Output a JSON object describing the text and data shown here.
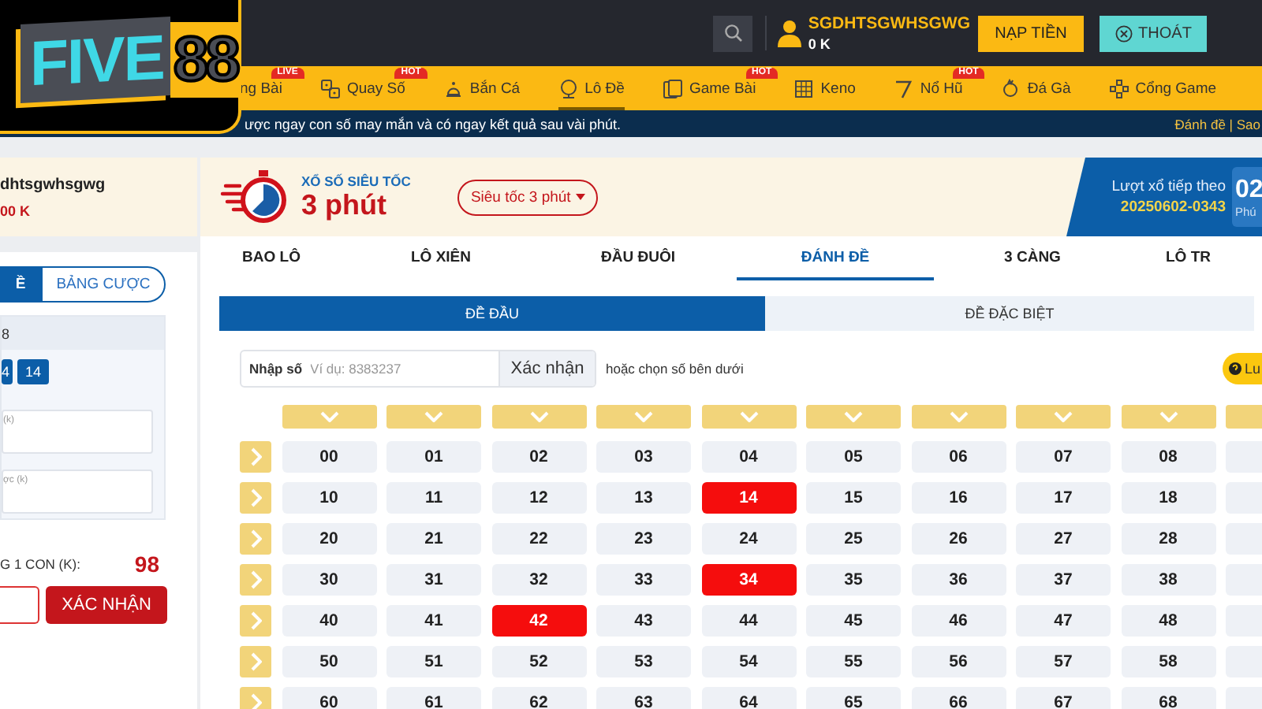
{
  "logo": {
    "word": "FIVE",
    "number": "88"
  },
  "account_bar": {
    "username": "SGDHTSGWHSGWG",
    "balance": "0 K",
    "deposit_button": "NẠP TIỀN",
    "logout_button": "THOÁT"
  },
  "nav": [
    {
      "label": "ng Bài",
      "kind": "cut",
      "badge": "LIVE",
      "selected": false
    },
    {
      "label": "Quay Số",
      "kind": "dice",
      "badge": "HOT",
      "selected": false
    },
    {
      "label": "Bắn Cá",
      "kind": "fish",
      "selected": false
    },
    {
      "label": "Lô Đề",
      "kind": "ball",
      "selected": true
    },
    {
      "label": "Game Bài",
      "kind": "cards",
      "badge": "HOT",
      "selected": false
    },
    {
      "label": "Keno",
      "kind": "grid",
      "selected": false
    },
    {
      "label": "Nổ Hũ",
      "kind": "seven",
      "badge": "HOT",
      "selected": false
    },
    {
      "label": "Đá Gà",
      "kind": "rooster",
      "selected": false
    },
    {
      "label": "Cổng Game",
      "kind": "pad",
      "selected": false
    }
  ],
  "ticker": {
    "message": "ược ngay con số may mắn và có ngay kết quả sau vài phút.",
    "links": "Đánh đề | Sao"
  },
  "sidebar": {
    "account_name": "dhtsgwhsgwg",
    "account_balance": "00 K",
    "tabs": [
      {
        "label": "Ề",
        "selected": true
      },
      {
        "label": "BẢNG CƯỢC",
        "selected": false
      }
    ],
    "ticket": {
      "title": "8",
      "numbers": [
        "4",
        "14"
      ],
      "fields": [
        {
          "label": "(k)"
        },
        {
          "label": "ợc (k)"
        }
      ]
    },
    "total_label": "G 1 CON (K):",
    "total_value": "98",
    "confirm_button": "XÁC NHẬN"
  },
  "game": {
    "subtitle": "XỔ SỐ SIÊU TỐC",
    "title": "3 phút",
    "mode_dropdown": "Siêu tốc 3 phút",
    "next_draw_label": "Lượt xổ tiếp theo",
    "next_draw_id": "20250602-0343",
    "countdown_value": "02",
    "countdown_unit": "Phú"
  },
  "bet_tabs": [
    {
      "label": "BAO LÔ",
      "selected": false
    },
    {
      "label": "LÔ XIÊN",
      "selected": false
    },
    {
      "label": "ĐẦU ĐUÔI",
      "selected": false
    },
    {
      "label": "ĐÁNH ĐỀ",
      "selected": true
    },
    {
      "label": "3 CÀNG",
      "selected": false
    },
    {
      "label": "LÔ TR",
      "selected": false
    }
  ],
  "sub_tabs": [
    {
      "label": "ĐỀ ĐẦU",
      "selected": true
    },
    {
      "label": "ĐỀ ĐẶC BIỆT",
      "selected": false
    }
  ],
  "number_input": {
    "label": "Nhập số",
    "placeholder": "Ví dụ: 8383237",
    "button": "Xác nhận",
    "hint": "hoặc chọn số bên dưới"
  },
  "help_button": "Lu",
  "number_grid": {
    "rows": [
      {
        "cells": [
          {
            "label": "00",
            "selected": false
          },
          {
            "label": "01",
            "selected": false
          },
          {
            "label": "02",
            "selected": false
          },
          {
            "label": "03",
            "selected": false
          },
          {
            "label": "04",
            "selected": false
          },
          {
            "label": "05",
            "selected": false
          },
          {
            "label": "06",
            "selected": false
          },
          {
            "label": "07",
            "selected": false
          },
          {
            "label": "08",
            "selected": false
          }
        ]
      },
      {
        "cells": [
          {
            "label": "10",
            "selected": false
          },
          {
            "label": "11",
            "selected": false
          },
          {
            "label": "12",
            "selected": false
          },
          {
            "label": "13",
            "selected": false
          },
          {
            "label": "14",
            "selected": true
          },
          {
            "label": "15",
            "selected": false
          },
          {
            "label": "16",
            "selected": false
          },
          {
            "label": "17",
            "selected": false
          },
          {
            "label": "18",
            "selected": false
          }
        ]
      },
      {
        "cells": [
          {
            "label": "20",
            "selected": false
          },
          {
            "label": "21",
            "selected": false
          },
          {
            "label": "22",
            "selected": false
          },
          {
            "label": "23",
            "selected": false
          },
          {
            "label": "24",
            "selected": false
          },
          {
            "label": "25",
            "selected": false
          },
          {
            "label": "26",
            "selected": false
          },
          {
            "label": "27",
            "selected": false
          },
          {
            "label": "28",
            "selected": false
          }
        ]
      },
      {
        "cells": [
          {
            "label": "30",
            "selected": false
          },
          {
            "label": "31",
            "selected": false
          },
          {
            "label": "32",
            "selected": false
          },
          {
            "label": "33",
            "selected": false
          },
          {
            "label": "34",
            "selected": true
          },
          {
            "label": "35",
            "selected": false
          },
          {
            "label": "36",
            "selected": false
          },
          {
            "label": "37",
            "selected": false
          },
          {
            "label": "38",
            "selected": false
          }
        ]
      },
      {
        "cells": [
          {
            "label": "40",
            "selected": false
          },
          {
            "label": "41",
            "selected": false
          },
          {
            "label": "42",
            "selected": true
          },
          {
            "label": "43",
            "selected": false
          },
          {
            "label": "44",
            "selected": false
          },
          {
            "label": "45",
            "selected": false
          },
          {
            "label": "46",
            "selected": false
          },
          {
            "label": "47",
            "selected": false
          },
          {
            "label": "48",
            "selected": false
          }
        ]
      },
      {
        "cells": [
          {
            "label": "50",
            "selected": false
          },
          {
            "label": "51",
            "selected": false
          },
          {
            "label": "52",
            "selected": false
          },
          {
            "label": "53",
            "selected": false
          },
          {
            "label": "54",
            "selected": false
          },
          {
            "label": "55",
            "selected": false
          },
          {
            "label": "56",
            "selected": false
          },
          {
            "label": "57",
            "selected": false
          },
          {
            "label": "58",
            "selected": false
          }
        ]
      },
      {
        "cells": [
          {
            "label": "60",
            "selected": false
          },
          {
            "label": "61",
            "selected": false
          },
          {
            "label": "62",
            "selected": false
          },
          {
            "label": "63",
            "selected": false
          },
          {
            "label": "64",
            "selected": false
          },
          {
            "label": "65",
            "selected": false
          },
          {
            "label": "66",
            "selected": false
          },
          {
            "label": "67",
            "selected": false
          },
          {
            "label": "68",
            "selected": false
          }
        ]
      }
    ]
  }
}
